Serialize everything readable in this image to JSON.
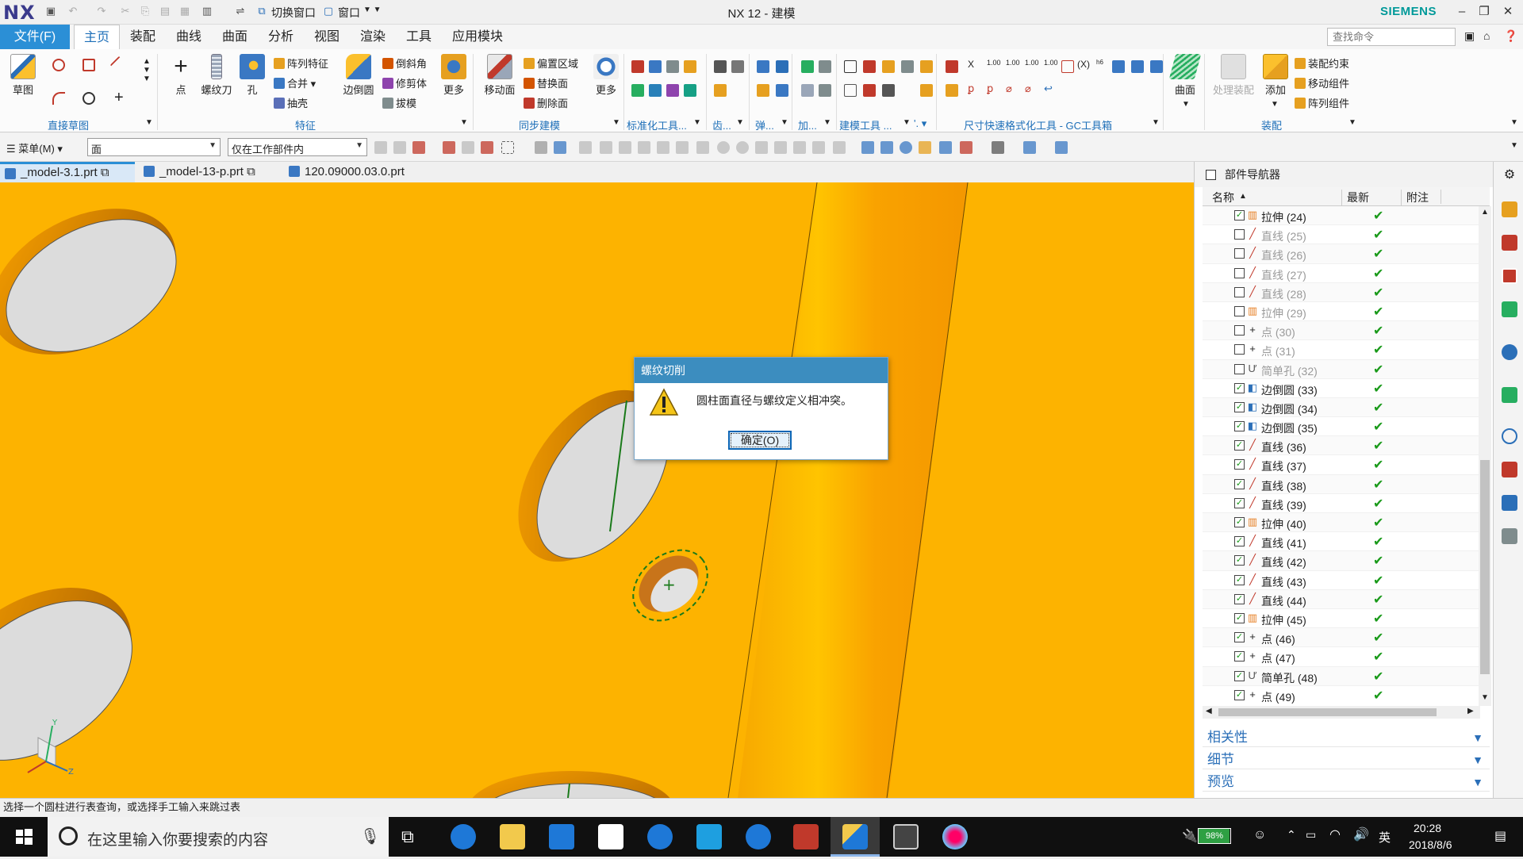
{
  "app": {
    "logo": "NX",
    "title": "NX 12 - 建模",
    "brand": "SIEMENS",
    "quick_access": {
      "switch_window": "切换窗口",
      "window": "窗口"
    },
    "window_buttons": [
      "–",
      "❐",
      "✕"
    ]
  },
  "ribbon_tabs": {
    "file": "文件(F)",
    "tabs": [
      "主页",
      "装配",
      "曲线",
      "曲面",
      "分析",
      "视图",
      "渲染",
      "工具",
      "应用模块"
    ],
    "active_tab": "主页",
    "search_placeholder": "查找命令"
  },
  "ribbon": {
    "groups": {
      "direct_sketch": "直接草图",
      "feature": "特征",
      "sync_modeling": "同步建模",
      "standard_tools": "标准化工具...",
      "gear": "齿...",
      "spring": "弹...",
      "process": "加...",
      "modeling_tools": "建模工具 ...",
      "dim_format": "尺寸快速格式化工具 - GC工具箱",
      "assembly": "装配"
    },
    "buttons": {
      "sketch": "草图",
      "point": "点",
      "thread_tool": "螺纹刀",
      "hole": "孔",
      "array_feature": "阵列特征",
      "unite": "合并",
      "shell": "抽壳",
      "edge_blend": "边倒圆",
      "chamfer": "倒斜角",
      "trim_body": "修剪体",
      "draft": "拔模",
      "more1": "更多",
      "move_face": "移动面",
      "offset_region": "偏置区域",
      "replace_face": "替换面",
      "delete_face": "删除面",
      "more2": "更多",
      "surface": "曲面",
      "process_assembly": "处理装配",
      "add": "添加",
      "assembly_constraint": "装配约束",
      "move_component": "移动组件",
      "array_component": "阵列组件"
    }
  },
  "selection_bar": {
    "menu": "菜单(M)",
    "type_filter": "面",
    "scope": "仅在工作部件内"
  },
  "doc_tabs": [
    {
      "name": "_model-3.1.prt",
      "active": true
    },
    {
      "name": "_model-13-p.prt",
      "active": false
    },
    {
      "name": "120.09000.03.0.prt",
      "active": false
    }
  ],
  "navigator": {
    "title": "部件导航器",
    "columns": {
      "name": "名称",
      "latest": "最新",
      "note": "附注"
    },
    "rows": [
      {
        "label": "拉伸 (24)",
        "checked": true,
        "icon": "extrude-icon",
        "dim": false
      },
      {
        "label": "直线 (25)",
        "checked": false,
        "icon": "line-icon",
        "dim": true
      },
      {
        "label": "直线 (26)",
        "checked": false,
        "icon": "line-icon",
        "dim": true
      },
      {
        "label": "直线 (27)",
        "checked": false,
        "icon": "line-icon",
        "dim": true
      },
      {
        "label": "直线 (28)",
        "checked": false,
        "icon": "line-icon",
        "dim": true
      },
      {
        "label": "拉伸 (29)",
        "checked": false,
        "icon": "extrude-icon",
        "dim": true
      },
      {
        "label": "点 (30)",
        "checked": false,
        "icon": "point-icon",
        "dim": true
      },
      {
        "label": "点 (31)",
        "checked": false,
        "icon": "point-icon",
        "dim": true
      },
      {
        "label": "简单孔 (32)",
        "checked": false,
        "icon": "hole-icon",
        "dim": true
      },
      {
        "label": "边倒圆 (33)",
        "checked": true,
        "icon": "blend-icon",
        "dim": false
      },
      {
        "label": "边倒圆 (34)",
        "checked": true,
        "icon": "blend-icon",
        "dim": false
      },
      {
        "label": "边倒圆 (35)",
        "checked": true,
        "icon": "blend-icon",
        "dim": false
      },
      {
        "label": "直线 (36)",
        "checked": true,
        "icon": "line-icon",
        "dim": false
      },
      {
        "label": "直线 (37)",
        "checked": true,
        "icon": "line-icon",
        "dim": false
      },
      {
        "label": "直线 (38)",
        "checked": true,
        "icon": "line-icon",
        "dim": false
      },
      {
        "label": "直线 (39)",
        "checked": true,
        "icon": "line-icon",
        "dim": false
      },
      {
        "label": "拉伸 (40)",
        "checked": true,
        "icon": "extrude-icon",
        "dim": false
      },
      {
        "label": "直线 (41)",
        "checked": true,
        "icon": "line-icon",
        "dim": false
      },
      {
        "label": "直线 (42)",
        "checked": true,
        "icon": "line-icon",
        "dim": false
      },
      {
        "label": "直线 (43)",
        "checked": true,
        "icon": "line-icon",
        "dim": false
      },
      {
        "label": "直线 (44)",
        "checked": true,
        "icon": "line-icon",
        "dim": false
      },
      {
        "label": "拉伸 (45)",
        "checked": true,
        "icon": "extrude-icon",
        "dim": false
      },
      {
        "label": "点 (46)",
        "checked": true,
        "icon": "point-icon",
        "dim": false
      },
      {
        "label": "点 (47)",
        "checked": true,
        "icon": "point-icon",
        "dim": false
      },
      {
        "label": "简单孔 (48)",
        "checked": true,
        "icon": "hole-icon",
        "dim": false
      },
      {
        "label": "点 (49)",
        "checked": true,
        "icon": "point-icon",
        "dim": false
      }
    ],
    "sections": [
      "相关性",
      "细节",
      "预览"
    ]
  },
  "dialog": {
    "title": "螺纹切削",
    "message": "圆柱面直径与螺纹定义相冲突。",
    "ok": "确定(O)"
  },
  "status": {
    "prompt": "选择一个圆柱进行表查询，或选择手工输入来跳过表"
  },
  "taskbar": {
    "search_placeholder": "在这里输入你要搜索的内容",
    "battery": "98%",
    "battery_level": 0.98,
    "ime": "英",
    "time": "20:28",
    "date": "2018/8/6"
  },
  "colors": {
    "viewport_bg": "#fdb300",
    "accent": "#2b8fd6",
    "dialog_title": "#3c8dbf",
    "check_green": "#1a9a1a"
  }
}
